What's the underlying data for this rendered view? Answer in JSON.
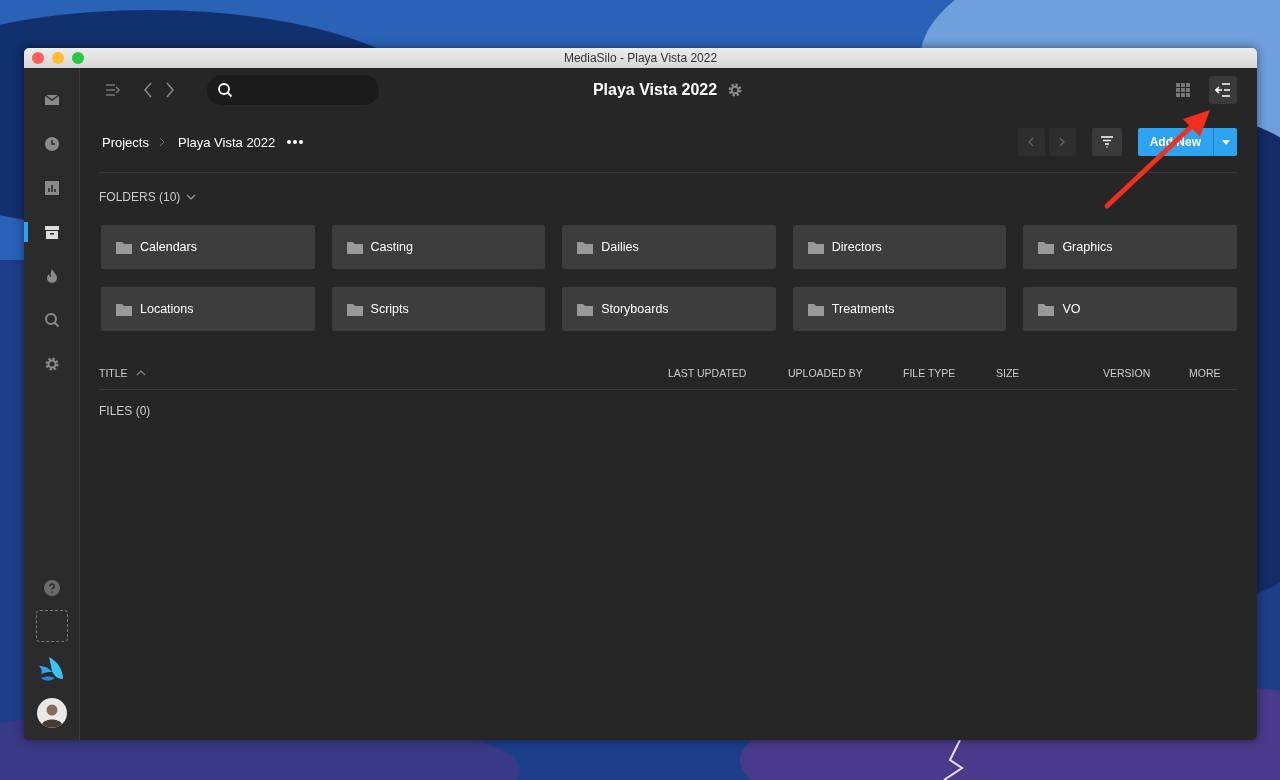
{
  "window": {
    "title": "MediaSilo - Playa Vista 2022"
  },
  "sidebar": {
    "items": [
      {
        "kind": "mail",
        "selected": false
      },
      {
        "kind": "clock",
        "selected": false
      },
      {
        "kind": "chart",
        "selected": false
      },
      {
        "kind": "archive",
        "selected": true
      },
      {
        "kind": "flame",
        "selected": false
      },
      {
        "kind": "search",
        "selected": false
      },
      {
        "kind": "gear",
        "selected": false
      }
    ]
  },
  "toolbar": {
    "project_title": "Playa Vista 2022"
  },
  "breadcrumb": [
    "Projects",
    "Playa Vista 2022"
  ],
  "add_button": "Add New",
  "folders_header": "FOLDERS (10)",
  "folders": [
    "Calendars",
    "Casting",
    "Dailies",
    "Directors",
    "Graphics",
    "Locations",
    "Scripts",
    "Storyboards",
    "Treatments",
    "VO"
  ],
  "columns": [
    {
      "label": "TITLE",
      "sorted": true
    },
    {
      "label": "LAST UPDATED",
      "sorted": false
    },
    {
      "label": "UPLOADED BY",
      "sorted": false
    },
    {
      "label": "FILE TYPE",
      "sorted": false
    },
    {
      "label": "SIZE",
      "sorted": false
    },
    {
      "label": "VERSION",
      "sorted": false
    },
    {
      "label": "MORE",
      "sorted": false
    }
  ],
  "files_label": "FILES (0)",
  "annotations": [
    {
      "kind": "arrow"
    }
  ]
}
